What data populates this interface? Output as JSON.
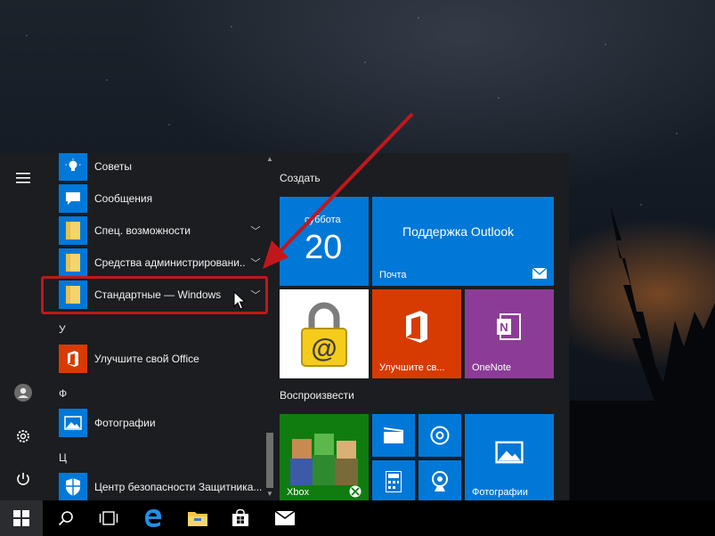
{
  "start_menu": {
    "apps": [
      {
        "label": "Советы",
        "icon": "lightbulb-icon",
        "color": "#0078d7"
      },
      {
        "label": "Сообщения",
        "icon": "message-icon",
        "color": "#0078d7"
      },
      {
        "label": "Спец. возможности",
        "icon": "folder-icon",
        "color": "#0078d7",
        "expandable": true
      },
      {
        "label": "Средства администрировани...",
        "icon": "folder-icon",
        "color": "#0078d7",
        "expandable": true
      },
      {
        "label": "Стандартные — Windows",
        "icon": "folder-icon",
        "color": "#0078d7",
        "expandable": true,
        "highlighted": true
      }
    ],
    "letter_u": "У",
    "app_office": {
      "label": "Улучшите свой Office",
      "icon": "office-icon",
      "color": "#d83b01"
    },
    "letter_f": "Ф",
    "app_photos": {
      "label": "Фотографии",
      "icon": "photos-icon",
      "color": "#0078d7"
    },
    "letter_ts": "Ц",
    "app_defender": {
      "label": "Центр безопасности Защитника...",
      "icon": "shield-icon",
      "color": "#0078d7"
    },
    "scroll_position": 0.85
  },
  "tiles": {
    "group_create": "Создать",
    "calendar": {
      "day": "суббота",
      "date": "20",
      "color": "#0078d7"
    },
    "mail": {
      "title": "Поддержка Outlook",
      "label": "Почта",
      "color": "#0078d7"
    },
    "keeper": {
      "color": "#ffffff"
    },
    "office": {
      "label": "Улучшите св...",
      "color": "#d83b01"
    },
    "onenote": {
      "label": "OneNote",
      "color": "#8c3c97"
    },
    "group_play": "Воспроизвести",
    "xbox": {
      "label": "Xbox",
      "color": "#107c10"
    },
    "photos": {
      "label": "Фотографии",
      "color": "#0078d7"
    },
    "small_color": "#0078d7"
  },
  "annotation": {
    "color": "#c1171b"
  }
}
